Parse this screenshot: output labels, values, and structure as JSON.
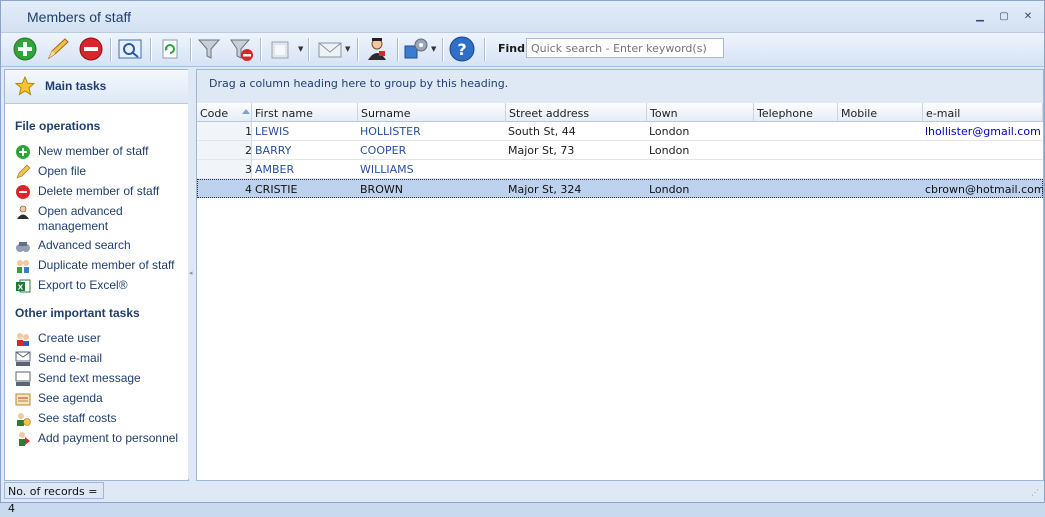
{
  "window": {
    "title": "Members of staff",
    "controls": [
      "minimize",
      "restore",
      "close"
    ]
  },
  "toolbar": {
    "buttons": [
      {
        "name": "add-button",
        "icon": "plus-circle-icon"
      },
      {
        "name": "edit-button",
        "icon": "pencil-icon"
      },
      {
        "name": "delete-button",
        "icon": "minus-circle-icon"
      },
      {
        "name": "preview-button",
        "icon": "magnifier-icon"
      },
      {
        "name": "refresh-button",
        "icon": "refresh-icon"
      },
      {
        "name": "filter-button",
        "icon": "funnel-icon"
      },
      {
        "name": "clear-filter-button",
        "icon": "funnel-remove-icon"
      },
      {
        "name": "print-button",
        "icon": "printer-icon"
      },
      {
        "name": "mail-button",
        "icon": "envelope-icon"
      },
      {
        "name": "advanced-management-button",
        "icon": "person-icon"
      },
      {
        "name": "tools-button",
        "icon": "gear-icon"
      },
      {
        "name": "help-button",
        "icon": "help-icon"
      }
    ],
    "find_label": "Find",
    "search_placeholder": "Quick search - Enter keyword(s)"
  },
  "sidebar": {
    "header": "Main tasks",
    "sections": [
      {
        "title": "File operations",
        "items": [
          {
            "label": "New member of staff",
            "icon": "plus-circle-icon"
          },
          {
            "label": "Open file",
            "icon": "pencil-icon"
          },
          {
            "label": "Delete member of staff",
            "icon": "minus-circle-icon"
          },
          {
            "label": "Open advanced management",
            "icon": "person-icon"
          },
          {
            "label": "Advanced search",
            "icon": "binoculars-icon"
          },
          {
            "label": "Duplicate member of staff",
            "icon": "duplicate-icon"
          },
          {
            "label": "Export to Excel®",
            "icon": "excel-icon"
          }
        ]
      },
      {
        "title": "Other important tasks",
        "items": [
          {
            "label": "Create user",
            "icon": "users-icon"
          },
          {
            "label": "Send e-mail",
            "icon": "email-icon"
          },
          {
            "label": "Send text message",
            "icon": "sms-icon"
          },
          {
            "label": "See agenda",
            "icon": "agenda-icon"
          },
          {
            "label": "See staff costs",
            "icon": "costs-icon"
          },
          {
            "label": "Add payment to personnel",
            "icon": "payment-icon"
          }
        ]
      }
    ]
  },
  "grid": {
    "group_hint": "Drag a column heading here to group by this heading.",
    "columns": [
      "Code",
      "First name",
      "Surname",
      "Street address",
      "Town",
      "Telephone",
      "Mobile",
      "e-mail"
    ],
    "rows": [
      {
        "code": "1",
        "first": "LEWIS",
        "surname": "HOLLISTER",
        "street": "South St, 44",
        "town": "London",
        "telephone": "",
        "mobile": "",
        "email": "lhollister@gmail.com"
      },
      {
        "code": "2",
        "first": "BARRY",
        "surname": "COOPER",
        "street": "Major St, 73",
        "town": "London",
        "telephone": "",
        "mobile": "",
        "email": ""
      },
      {
        "code": "3",
        "first": "AMBER",
        "surname": "WILLIAMS",
        "street": "",
        "town": "",
        "telephone": "",
        "mobile": "",
        "email": ""
      },
      {
        "code": "4",
        "first": "CRISTIE",
        "surname": "BROWN",
        "street": "Major St, 324",
        "town": "London",
        "telephone": "",
        "mobile": "",
        "email": "cbrown@hotmail.com"
      }
    ],
    "selected_row": 3
  },
  "status": {
    "records": "No. of records = 4"
  }
}
